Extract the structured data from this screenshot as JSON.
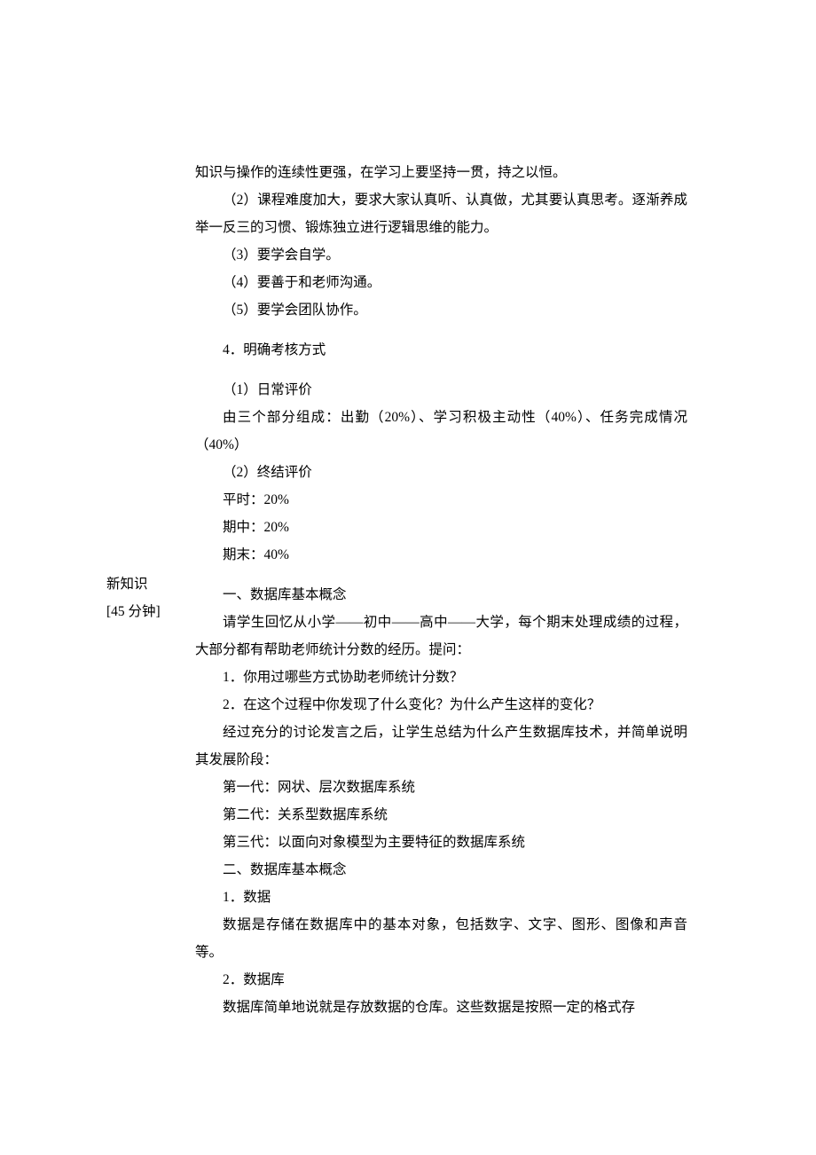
{
  "sidebar": {
    "label1": "新知识",
    "label2": "[45 分钟]"
  },
  "content": {
    "p01": "知识与操作的连续性更强，在学习上要坚持一贯，持之以恒。",
    "p02": "（2）课程难度加大，要求大家认真听、认真做，尤其要认真思考。逐渐养成举一反三的习惯、锻炼独立进行逻辑思维的能力。",
    "p03": "（3）要学会自学。",
    "p04": "（4）要善于和老师沟通。",
    "p05": "（5）要学会团队协作。",
    "p06": "4．明确考核方式",
    "p07": "（1）日常评价",
    "p08": "由三个部分组成：出勤（20%）、学习积极主动性（40%）、任务完成情况（40%）",
    "p09": "（2）终结评价",
    "p10": "平时：20%",
    "p11": "期中：20%",
    "p12": "期末：40%",
    "p13": "一、数据库基本概念",
    "p14": "请学生回忆从小学——初中——高中——大学，每个期末处理成绩的过程，大部分都有帮助老师统计分数的经历。提问：",
    "p15": "1．你用过哪些方式协助老师统计分数？",
    "p16": "2．在这个过程中你发现了什么变化？为什么产生这样的变化？",
    "p17": "经过充分的讨论发言之后，让学生总结为什么产生数据库技术，并简单说明其发展阶段：",
    "p18": "第一代：网状、层次数据库系统",
    "p19": "第二代：关系型数据库系统",
    "p20": "第三代：以面向对象模型为主要特征的数据库系统",
    "p21": "二、数据库基本概念",
    "p22": "1．数据",
    "p23": "数据是存储在数据库中的基本对象，包括数字、文字、图形、图像和声音等。",
    "p24": "2．数据库",
    "p25": "数据库简单地说就是存放数据的仓库。这些数据是按照一定的格式存"
  }
}
